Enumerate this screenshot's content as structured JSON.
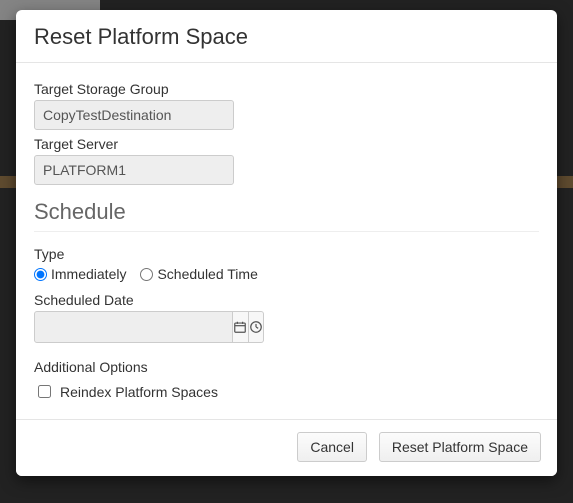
{
  "dialog": {
    "title": "Reset Platform Space",
    "target_storage_group": {
      "label": "Target Storage Group",
      "value": "CopyTestDestination"
    },
    "target_server": {
      "label": "Target Server",
      "value": "PLATFORM1"
    },
    "schedule": {
      "heading": "Schedule",
      "type": {
        "label": "Type",
        "options": [
          {
            "label": "Immediately",
            "selected": true
          },
          {
            "label": "Scheduled Time",
            "selected": false
          }
        ]
      },
      "scheduled_date": {
        "label": "Scheduled Date",
        "value": ""
      },
      "additional_options": {
        "label": "Additional Options",
        "reindex": {
          "label": "Reindex Platform Spaces",
          "checked": false
        }
      }
    },
    "buttons": {
      "cancel": "Cancel",
      "submit": "Reset Platform Space"
    }
  }
}
